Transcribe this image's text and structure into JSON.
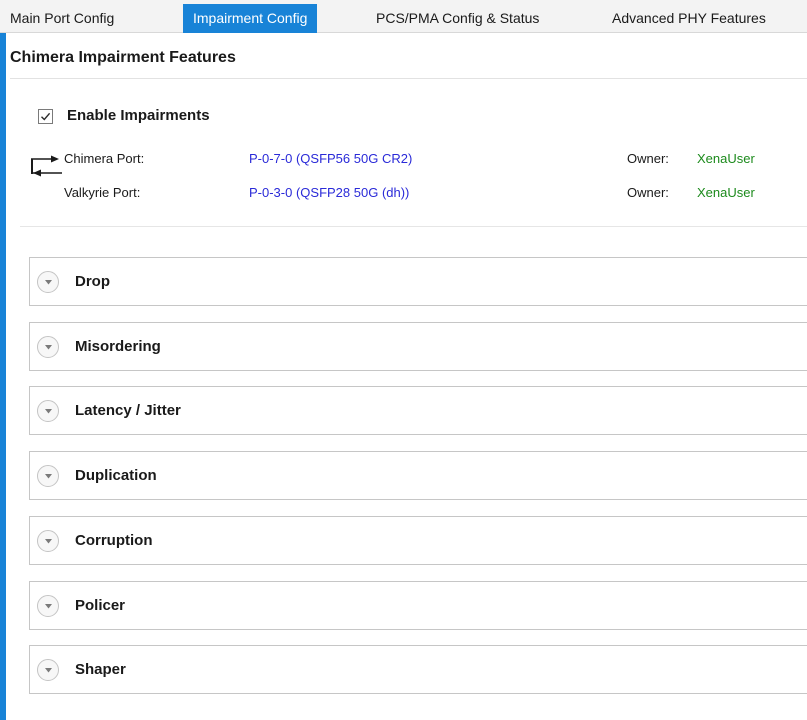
{
  "tabs": [
    {
      "label": "Main Port Config",
      "active": false
    },
    {
      "label": "Impairment Config",
      "active": true
    },
    {
      "label": "PCS/PMA Config & Status",
      "active": false
    },
    {
      "label": "Advanced PHY Features",
      "active": false
    }
  ],
  "section_title": "Chimera Impairment Features",
  "enable_impairments": {
    "label": "Enable Impairments",
    "checked": true
  },
  "ports": [
    {
      "label": "Chimera Port:",
      "value": "P-0-7-0 (QSFP56 50G CR2)",
      "owner_label": "Owner:",
      "owner": "XenaUser"
    },
    {
      "label": "Valkyrie Port:",
      "value": "P-0-3-0 (QSFP28 50G (dh))",
      "owner_label": "Owner:",
      "owner": "XenaUser"
    }
  ],
  "panels": [
    {
      "label": "Drop",
      "expanded": false
    },
    {
      "label": "Misordering",
      "expanded": false
    },
    {
      "label": "Latency / Jitter",
      "expanded": false
    },
    {
      "label": "Duplication",
      "expanded": false
    },
    {
      "label": "Corruption",
      "expanded": false
    },
    {
      "label": "Policer",
      "expanded": false
    },
    {
      "label": "Shaper",
      "expanded": false
    }
  ],
  "colors": {
    "accent": "#1883d7",
    "port_link": "#2a2ad8",
    "owner_text": "#1c8a1c"
  }
}
